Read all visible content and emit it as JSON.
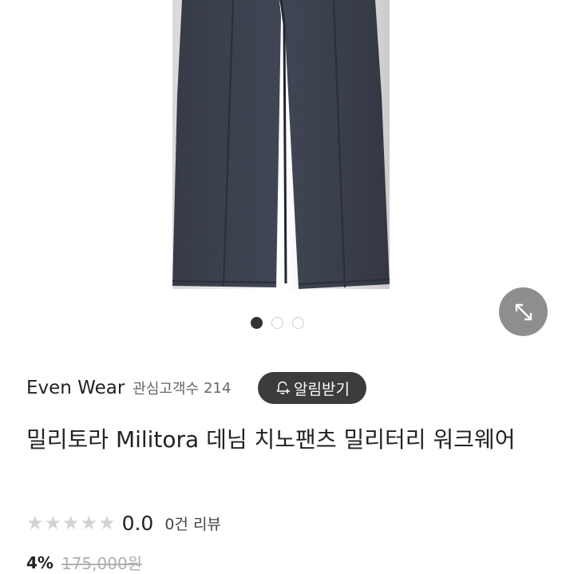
{
  "brand": {
    "name": "Even Wear",
    "follower_label": "관심고객수",
    "follower_count": "214",
    "alert_button_label": "알림받기"
  },
  "product": {
    "title": "밀리토라 Militora 데님 치노팬츠 밀리터리 워크웨어",
    "image_alt": "denim chino pants",
    "rating_score": "0.0",
    "review_count": "0건 리뷰",
    "star_count": 5,
    "rating_value": 0
  },
  "price": {
    "discount": "4%",
    "original": "175,000원"
  },
  "carousel": {
    "total": 3,
    "active_index": 0
  },
  "icons": {
    "expand": "expand-arrows-icon",
    "bell": "bell-plus-icon",
    "star": "star-icon"
  },
  "colors": {
    "denim": "#3a3f4d",
    "button_dark": "#3c3c3c",
    "expand_bg": "#8e8e8e",
    "star_empty": "#d3d3d3"
  }
}
